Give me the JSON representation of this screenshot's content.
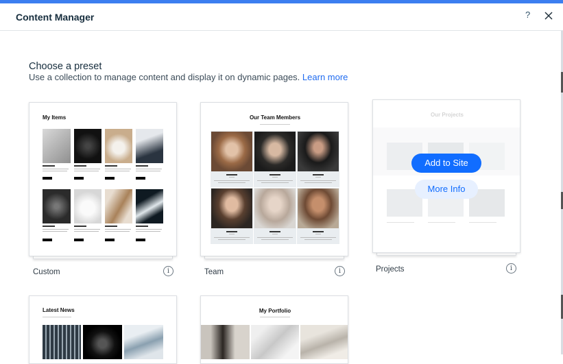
{
  "header": {
    "title": "Content Manager",
    "help_label": "?"
  },
  "intro": {
    "heading": "Choose a preset",
    "description": "Use a collection to manage content and display it on dynamic pages.",
    "learn_more": "Learn more"
  },
  "presets": [
    {
      "label": "Custom",
      "preview_title": "My Items",
      "icon": "info-icon"
    },
    {
      "label": "Team",
      "preview_title": "Our Team Members",
      "icon": "info-icon"
    },
    {
      "label": "Projects",
      "preview_title": "Our Projects",
      "icon": "info-icon",
      "hover_actions": {
        "primary": "Add to Site",
        "secondary": "More Info"
      }
    },
    {
      "label": "",
      "preview_title": "Latest News"
    },
    {
      "label": "",
      "preview_title": "My Portfolio"
    }
  ],
  "info_glyph": "i",
  "colors": {
    "accent": "#116dff",
    "top_bar": "#3c7ef0",
    "link": "#1f6bf0"
  }
}
